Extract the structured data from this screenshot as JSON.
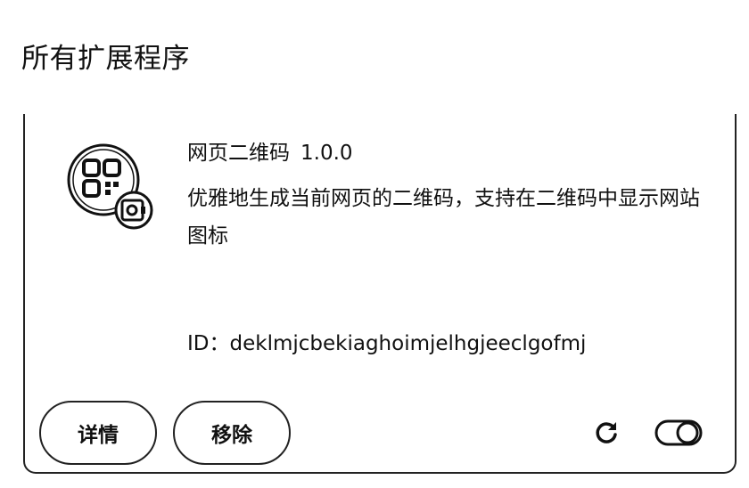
{
  "page": {
    "section_title": "所有扩展程序"
  },
  "extension": {
    "name": "网页二维码",
    "version": "1.0.0",
    "description": "优雅地生成当前网页的二维码，支持在二维码中显示网站图标",
    "id_text": "ID：deklmjcbekiaghoimjelhgjeeclgofmj",
    "icon": "qr-code-icon",
    "enabled": true
  },
  "actions": {
    "details_label": "详情",
    "remove_label": "移除",
    "reload_icon": "reload-icon",
    "toggle_icon": "toggle-switch"
  }
}
